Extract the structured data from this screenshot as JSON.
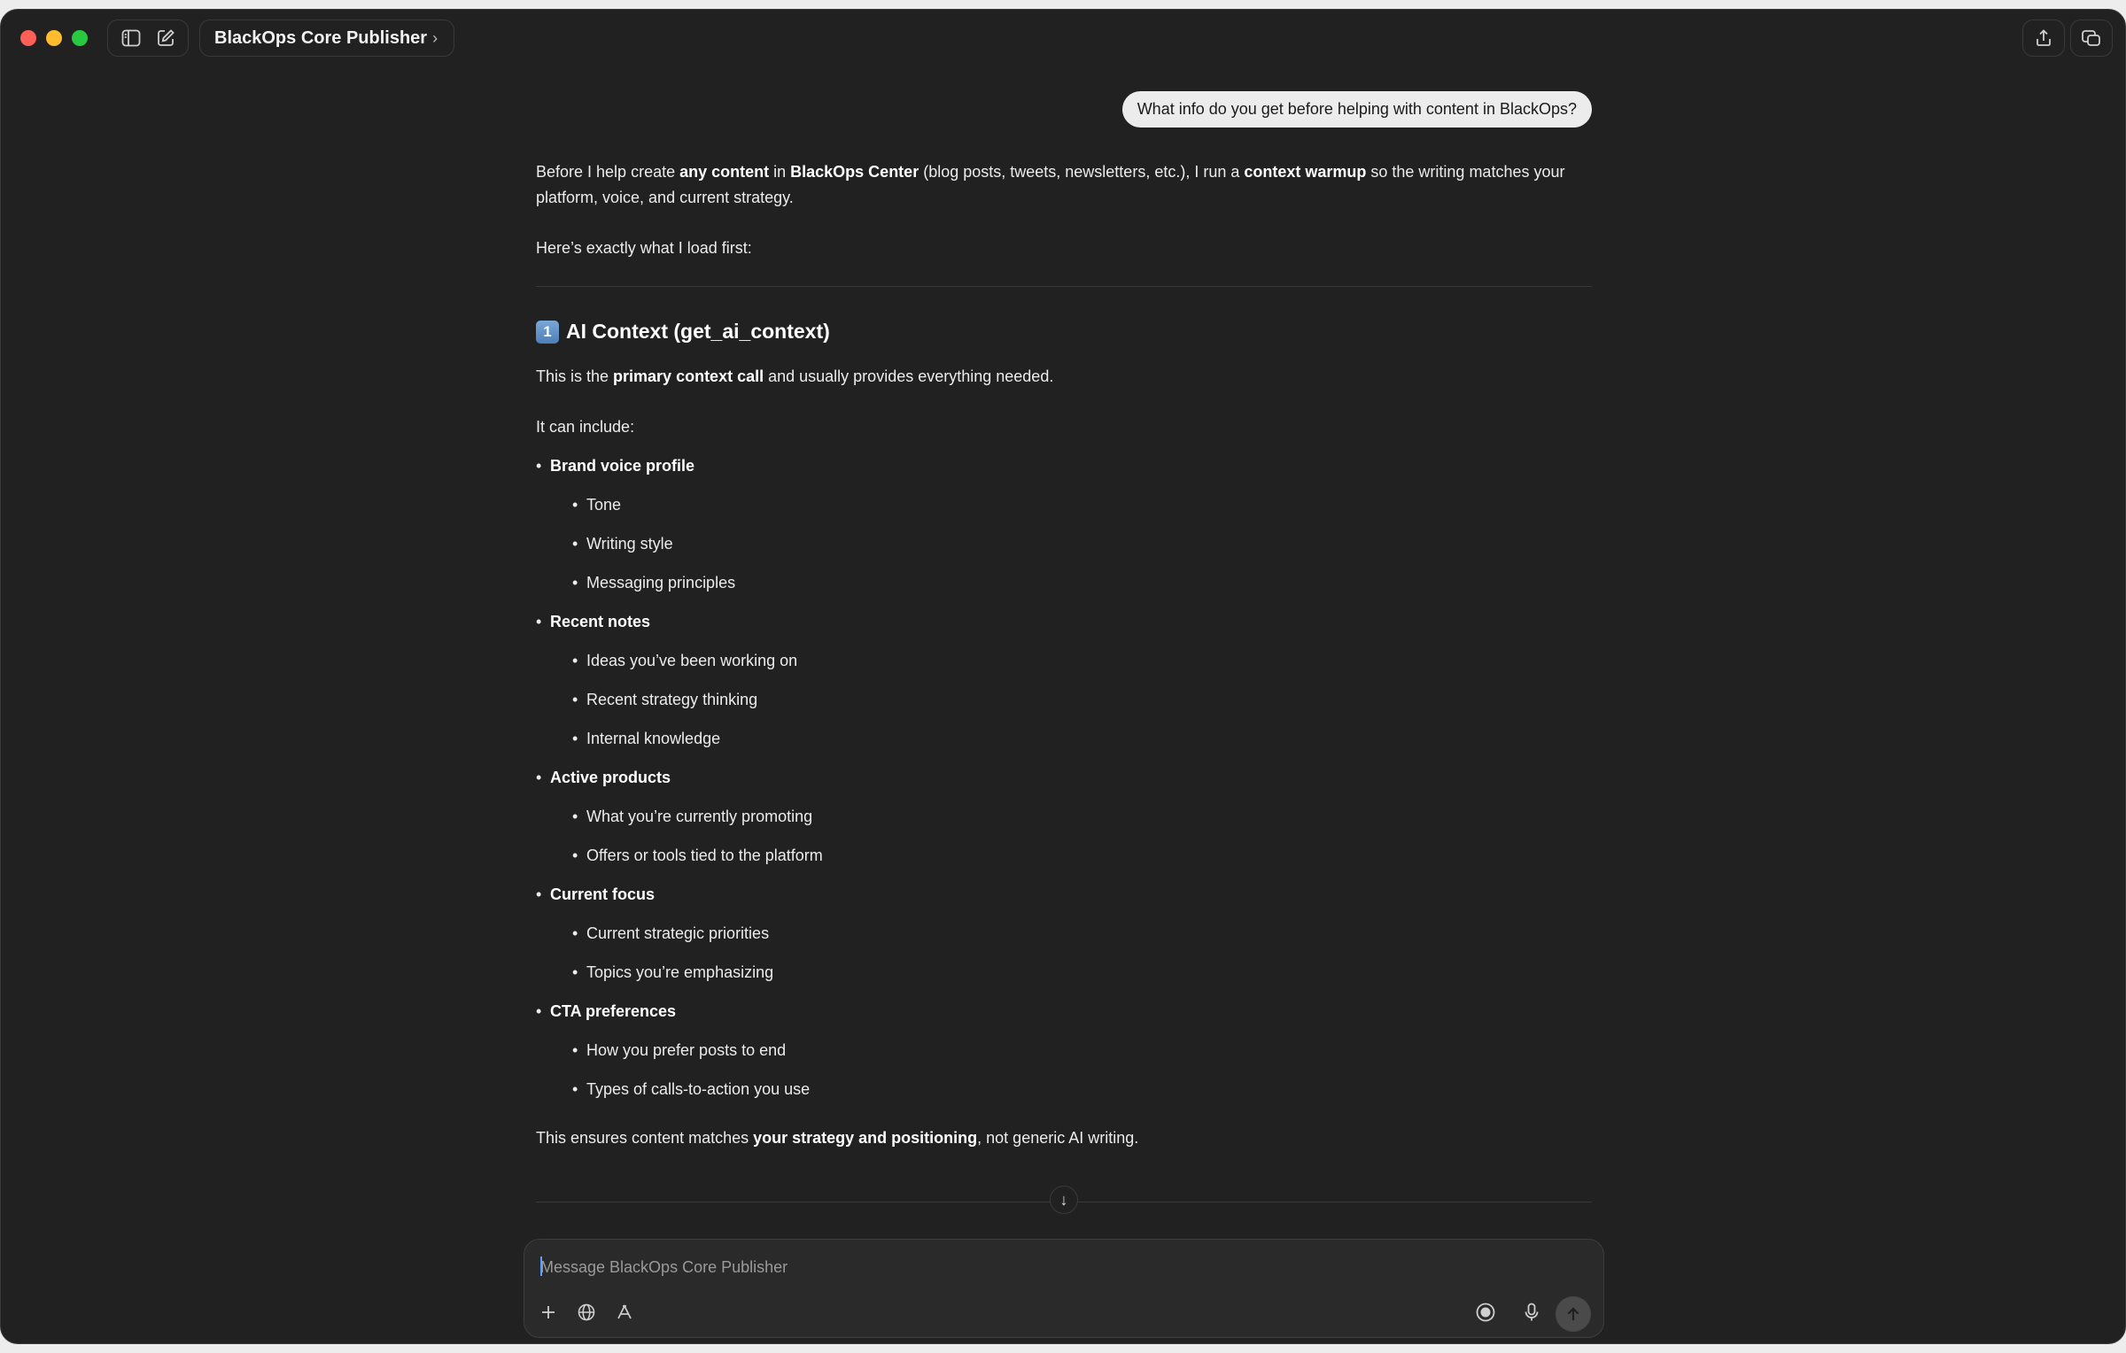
{
  "window": {
    "title": "BlackOps Core Publisher"
  },
  "user_message": "What info do you get before helping with content in BlackOps?",
  "assistant": {
    "intro_parts": [
      "Before I help create ",
      "any content",
      " in ",
      "BlackOps Center",
      " (blog posts, tweets, newsletters, etc.), I run a ",
      "context warmup",
      " so the writing matches your platform, voice, and current strategy."
    ],
    "lead": "Here’s exactly what I load first:",
    "section_number": "1",
    "section_title": "AI Context (get_ai_context)",
    "primary_parts": [
      "This is the ",
      "primary context call",
      " and usually provides everything needed."
    ],
    "can_include": "It can include:",
    "groups": [
      {
        "title": "Brand voice profile",
        "items": [
          "Tone",
          "Writing style",
          "Messaging principles"
        ]
      },
      {
        "title": "Recent notes",
        "items": [
          "Ideas you’ve been working on",
          "Recent strategy thinking",
          "Internal knowledge"
        ]
      },
      {
        "title": "Active products",
        "items": [
          "What you’re currently promoting",
          "Offers or tools tied to the platform"
        ]
      },
      {
        "title": "Current focus",
        "items": [
          "Current strategic priorities",
          "Topics you’re emphasizing"
        ]
      },
      {
        "title": "CTA preferences",
        "items": [
          "How you prefer posts to end",
          "Types of calls-to-action you use"
        ]
      }
    ],
    "closing_parts": [
      "This ensures content matches ",
      "your strategy and positioning",
      ", not generic AI writing."
    ]
  },
  "composer": {
    "placeholder": "Message BlackOps Core Publisher"
  },
  "icons": {
    "sidebar": "sidebar-toggle-icon",
    "new_chat": "compose-icon",
    "share": "share-icon",
    "new_window": "new-window-icon",
    "attach": "plus-icon",
    "web": "globe-icon",
    "tools": "tools-icon",
    "voice_mode": "voice-mode-icon",
    "dictate": "microphone-icon",
    "send": "send-arrow-icon",
    "scroll": "arrow-down-icon"
  },
  "colors": {
    "background": "#212121",
    "bubble": "#ececec",
    "traffic_red": "#fe5f57",
    "traffic_yellow": "#febc2e",
    "traffic_green": "#28c840",
    "caret": "#5aa0ff"
  }
}
